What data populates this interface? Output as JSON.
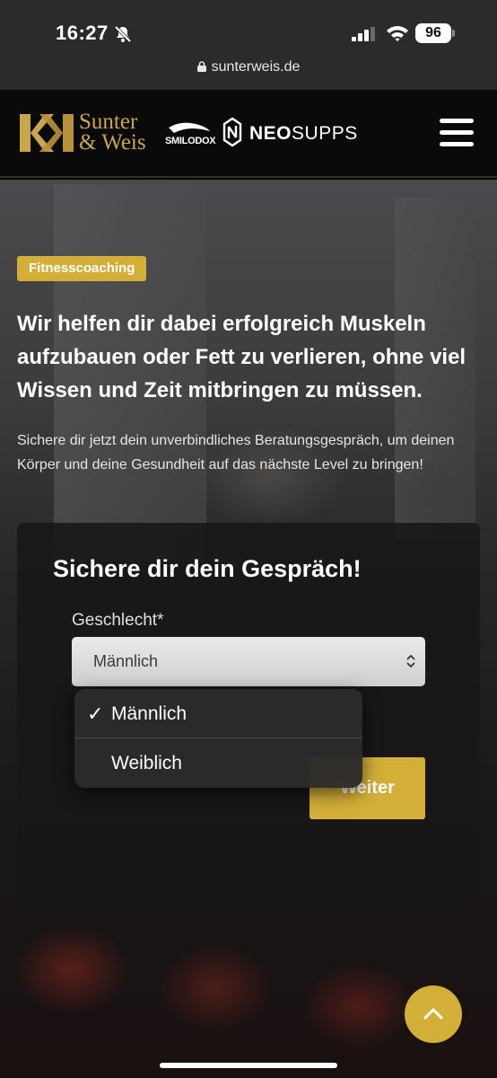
{
  "status_bar": {
    "time": "16:27",
    "battery": "96",
    "icons": [
      "bell-slash-icon",
      "signal-icon",
      "wifi-icon",
      "battery-icon"
    ]
  },
  "browser": {
    "url": "sunterweis.de"
  },
  "header": {
    "brand_line1": "Sunter",
    "brand_line2": "& Weis",
    "partner1": "SMILODOX",
    "partner2_bold": "NEO",
    "partner2_rest": "SUPPS",
    "menu_icon": "hamburger-menu-icon"
  },
  "hero": {
    "badge": "Fitnesscoaching",
    "headline": "Wir helfen dir dabei erfolgreich Muskeln aufzubauen oder Fett zu verlieren, ohne viel Wissen und Zeit mitbringen zu müssen.",
    "subline": "Sichere dir jetzt dein unverbindliches Beratungsgespräch, um deinen Körper und deine Gesundheit auf das nächste Level zu bringen!"
  },
  "form": {
    "title": "Sichere dir dein Gespräch!",
    "gender_label": "Geschlecht*",
    "gender_value": "Männlich",
    "next_button": "Weiter"
  },
  "dropdown": {
    "options": [
      {
        "label": "Männlich",
        "selected": true
      },
      {
        "label": "Weiblich",
        "selected": false
      }
    ],
    "check_mark": "✓"
  },
  "colors": {
    "accent_gold": "#d4af37",
    "header_bg": "#0a0a0a",
    "statusbar_bg": "#2b2b2d"
  }
}
